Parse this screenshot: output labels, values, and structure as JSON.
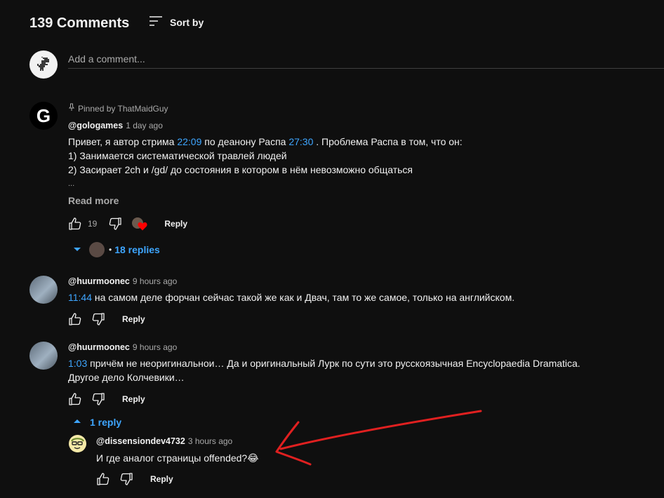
{
  "header": {
    "count_title": "139 Comments",
    "sort_label": "Sort by"
  },
  "add_comment": {
    "placeholder": "Add a comment..."
  },
  "comments": [
    {
      "pinned_label": "Pinned by ThatMaidGuy",
      "author": "@gologames",
      "time": "1 day ago",
      "line1_a": "Привет, я автор стрима ",
      "line1_ts1": "22:09",
      "line1_b": " по деанону Распа ",
      "line1_ts2": "27:30",
      "line1_c": " . Проблема Распа в том, что он:",
      "line2": "1) Занимается систематической травлей людей",
      "line3": "2) Засирает 2ch и /gd/ до состояния в котором в нём невозможно общаться",
      "line4": "...",
      "read_more": "Read more",
      "likes": "19",
      "reply_label": "Reply",
      "replies_label": "18 replies",
      "replies_dot": "•"
    },
    {
      "author": "@huurmoonec",
      "time": "9 hours ago",
      "ts": "11:44",
      "text": " на самом деле форчан сейчас такой же как и Двач, там то же самое, только на английском.",
      "reply_label": "Reply"
    },
    {
      "author": "@huurmoonec",
      "time": "9 hours ago",
      "ts": "1:03",
      "text": " причём не неоригинальнои… Да и оригинальный Лурк по сути это русскоязычная Encyclopaedia Dramatica.",
      "line2": "Другое дело Колчевики…",
      "reply_label": "Reply",
      "replies_label": "1 reply"
    }
  ],
  "reply": {
    "author": "@dissensiondev4732",
    "time": "3 hours ago",
    "text": "И где аналог страницы offended?",
    "emoji": "😂",
    "reply_label": "Reply"
  },
  "colors": {
    "background": "#0f0f0f",
    "link": "#3ea6ff",
    "secondary": "#aaaaaa",
    "annotation": "#e02020"
  }
}
